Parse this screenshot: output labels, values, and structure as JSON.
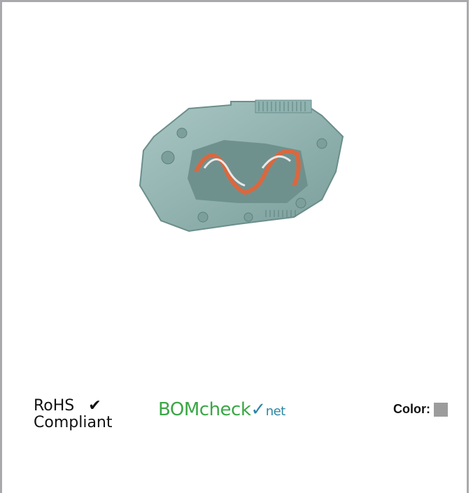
{
  "rohs": {
    "line1": "RoHS",
    "line2": "Compliant",
    "check_icon": "checkmark-icon",
    "check_glyph": "✔"
  },
  "bomcheck": {
    "part1": "BOMcheck",
    "tick": "✓",
    "part2": "net"
  },
  "color": {
    "label": "Color:",
    "swatch_hex": "#9c9c9c"
  },
  "colors": {
    "frame": "#a9a9ad",
    "terminal_body": "#8fb3b0",
    "spring_orange": "#d9683f",
    "bom_green": "#3aa745",
    "bom_blue": "#2b86a3"
  }
}
